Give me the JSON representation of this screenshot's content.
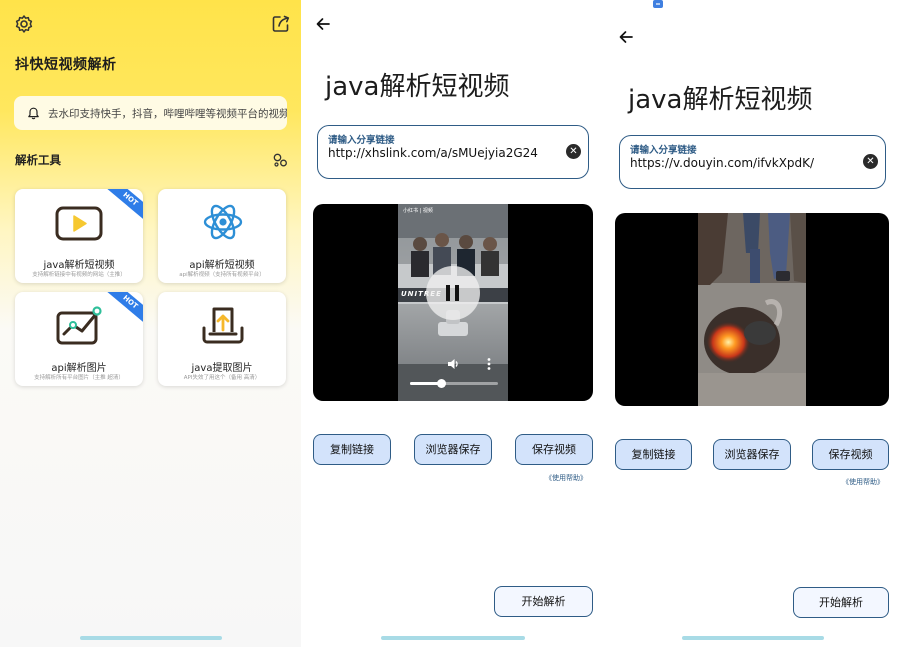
{
  "colors": {
    "accent_yellow": "#ffe34a",
    "hot_blue": "#2f7de8",
    "button_fill": "#d3e3fb",
    "button_border": "#2f5c86"
  },
  "home": {
    "title": "抖快短视频解析",
    "notice": "去水印支持快手，抖音，哔哩哔哩等视频平台的视频解析",
    "section_title": "解析工具",
    "hot_badge": "HOT",
    "cards": [
      {
        "title": "java解析短视频",
        "subtitle": "支持解析链接中有视频的网站（主推）",
        "icon": "play-video-icon",
        "hot": true
      },
      {
        "title": "api解析短视频",
        "subtitle": "api解析视频（支持所有视频平台）",
        "icon": "atom-icon",
        "hot": false
      },
      {
        "title": "api解析图片",
        "subtitle": "支持解析所有平台图片（主推 超清）",
        "icon": "line-chart-icon",
        "hot": true
      },
      {
        "title": "java提取图片",
        "subtitle": "API失效了用这个（备用 高清）",
        "icon": "tray-upload-icon",
        "hot": false
      }
    ]
  },
  "parse_a": {
    "title": "java解析短视频",
    "input_label": "请输入分享链接",
    "input_value": "http://xhslink.com/a/sMUejyia2G24",
    "video_overlay_text": "小红书 | 视频",
    "video_banner": "UNITREE",
    "progress": 0.36,
    "buttons": {
      "copy": "复制链接",
      "browser": "浏览器保存",
      "save": "保存视频",
      "start": "开始解析"
    },
    "help": "《使用帮助》"
  },
  "parse_b": {
    "title": "java解析短视频",
    "input_label": "请输入分享链接",
    "input_value": "https://v.douyin.com/ifvkXpdK/",
    "buttons": {
      "copy": "复制链接",
      "browser": "浏览器保存",
      "save": "保存视频",
      "start": "开始解析"
    },
    "help": "《使用帮助》"
  }
}
